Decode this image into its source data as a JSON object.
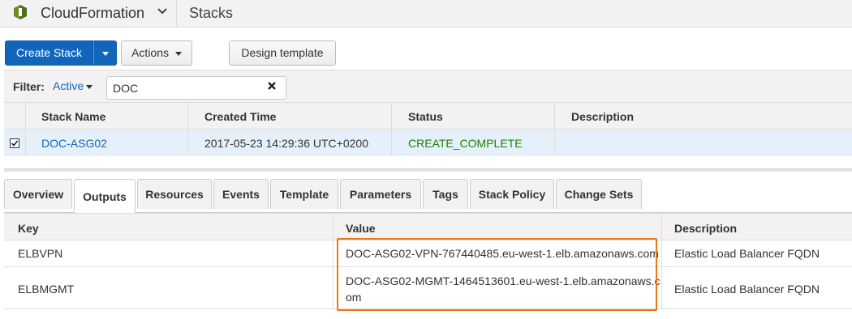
{
  "nav": {
    "service": "CloudFormation",
    "page": "Stacks"
  },
  "toolbar": {
    "create_label": "Create Stack",
    "actions_label": "Actions",
    "design_label": "Design template"
  },
  "filter": {
    "label": "Filter:",
    "status": "Active",
    "value": "DOC"
  },
  "stacks": {
    "columns": [
      "Stack Name",
      "Created Time",
      "Status",
      "Description"
    ],
    "rows": [
      {
        "name": "DOC-ASG02",
        "created": "2017-05-23 14:29:36 UTC+0200",
        "status": "CREATE_COMPLETE",
        "description": "",
        "checked": true
      }
    ]
  },
  "tabs": [
    "Overview",
    "Outputs",
    "Resources",
    "Events",
    "Template",
    "Parameters",
    "Tags",
    "Stack Policy",
    "Change Sets"
  ],
  "active_tab": "Outputs",
  "outputs": {
    "columns": [
      "Key",
      "Value",
      "Description"
    ],
    "rows": [
      {
        "key": "ELBVPN",
        "value": "DOC-ASG02-VPN-767440485.eu-west-1.elb.amazonaws.com",
        "description": "Elastic Load Balancer FQDN"
      },
      {
        "key": "ELBMGMT",
        "value_line1": "DOC-ASG02-MGMT-1464513601.eu-west-1.elb.amazonaws.c",
        "value_line2": "om",
        "description": "Elastic Load Balancer FQDN"
      }
    ]
  },
  "colors": {
    "primary": "#1166bb",
    "status_ok": "#1d8102",
    "highlight": "#ee7711"
  }
}
